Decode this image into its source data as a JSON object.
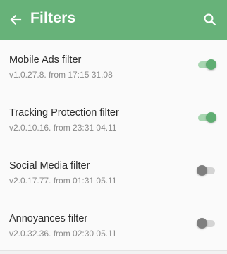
{
  "header": {
    "title": "Filters",
    "back_icon": "arrow-left-icon",
    "search_icon": "search-icon",
    "background_color": "#67b279"
  },
  "filters": [
    {
      "name": "Mobile Ads filter",
      "info": "v1.0.27.8. from 17:15 31.08",
      "enabled": true
    },
    {
      "name": "Tracking Protection filter",
      "info": "v2.0.10.16. from 23:31 04.11",
      "enabled": true
    },
    {
      "name": "Social Media filter",
      "info": "v2.0.17.77. from 01:31 05.11",
      "enabled": false
    },
    {
      "name": "Annoyances filter",
      "info": "v2.0.32.36. from 02:30 05.11",
      "enabled": false
    }
  ]
}
